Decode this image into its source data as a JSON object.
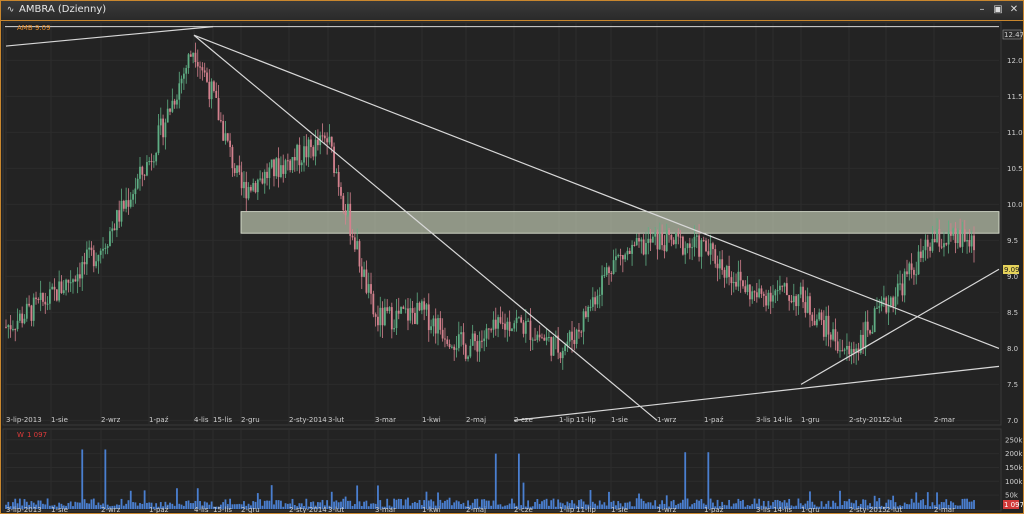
{
  "window": {
    "title": "AMBRA (Dzienny)",
    "minimize_icon": "minimize-icon",
    "restore_icon": "restore-icon",
    "close_icon": "close-icon"
  },
  "colors": {
    "up": "#5fae84",
    "down": "#d4818e",
    "line": "#d8d8d8",
    "volume": "#4a7fd0",
    "zone": "#d8e2c8",
    "border": "#c9872e"
  },
  "price_panel": {
    "legend_label": "AMB",
    "legend_value": "9.09",
    "y_ticks": [
      "12.0",
      "11.5",
      "11.0",
      "10.5",
      "10.0",
      "9.5",
      "9.0",
      "8.5",
      "8.0",
      "7.5",
      "7.0"
    ],
    "top_marker": "12.47",
    "last_marker": "9.09"
  },
  "volume_panel": {
    "legend_label": "W",
    "legend_value": "1 097",
    "y_ticks": [
      "250k",
      "200k",
      "150k",
      "100k",
      "50k"
    ],
    "last_marker": "1 097"
  },
  "x_labels": [
    "3-lip-2013",
    "1-sie",
    "2-wrz",
    "1-paź",
    "4-lis",
    "15-lis",
    "2-gru",
    "2-sty-2014",
    "3-lut",
    "3-mar",
    "1-kwi",
    "2-maj",
    "2-cze",
    "1-lip",
    "11-lip",
    "1-sie",
    "1-wrz",
    "1-paź",
    "3-lis",
    "14-lis",
    "1-gru",
    "2-sty-2015",
    "2-lut",
    "2-mar"
  ],
  "chart_data": [
    {
      "type": "line",
      "ticker": "AMB",
      "timeframe": "daily",
      "last_value": 9.09,
      "ylim": [
        7.0,
        12.47
      ],
      "x": [
        "3-lip-2013",
        "1-sie",
        "2-wrz",
        "1-paź",
        "4-lis",
        "15-lis",
        "2-gru",
        "2-sty-2014",
        "3-lut",
        "3-mar",
        "1-kwi",
        "2-maj",
        "2-cze",
        "1-lip",
        "11-lip",
        "1-sie",
        "1-wrz",
        "1-paź",
        "3-lis",
        "14-lis",
        "1-gru",
        "2-sty-2015",
        "2-lut",
        "2-mar"
      ],
      "series": [
        {
          "values": [
            8.3,
            8.7,
            9.4,
            10.6,
            12.2,
            11.5,
            10.2,
            10.6,
            10.9,
            8.4,
            8.5,
            8.0,
            8.4,
            8.0,
            8.2,
            9.2,
            9.5,
            9.4,
            8.7,
            8.8,
            8.7,
            7.9,
            8.6,
            9.5
          ]
        }
      ],
      "trend_lines": [
        {
          "from": [
            "3-lip-2013",
            12.2
          ],
          "to": [
            "15-lis",
            12.47
          ]
        },
        {
          "from": [
            "4-lis",
            12.35
          ],
          "to": [
            "2-mar",
            8.0
          ]
        },
        {
          "from": [
            "4-lis",
            12.35
          ],
          "to": [
            "1-wrz",
            7.0
          ]
        },
        {
          "from": [
            "2-cze",
            7.0
          ],
          "to": [
            "2-mar",
            7.75
          ]
        },
        {
          "from": [
            "1-gru",
            7.5
          ],
          "to": [
            "2-mar",
            9.1
          ]
        }
      ],
      "zone": {
        "y1": 9.6,
        "y2": 9.9,
        "from": "2-gru",
        "to": "2-mar"
      },
      "horizontal_line": 12.47
    },
    {
      "type": "bar",
      "ticker": "W",
      "last_value": 1097,
      "ylim": [
        0,
        260000
      ],
      "bar_peaks": [
        {
          "x": "2-wrz",
          "value": 215000
        },
        {
          "x": "4-lis",
          "value": 75000
        },
        {
          "x": "3-mar",
          "value": 85000
        },
        {
          "x": "2-cze",
          "value": 200000
        },
        {
          "x": "1-paź",
          "value": 205000
        },
        {
          "x": "2-mar",
          "value": 60000
        }
      ]
    }
  ]
}
